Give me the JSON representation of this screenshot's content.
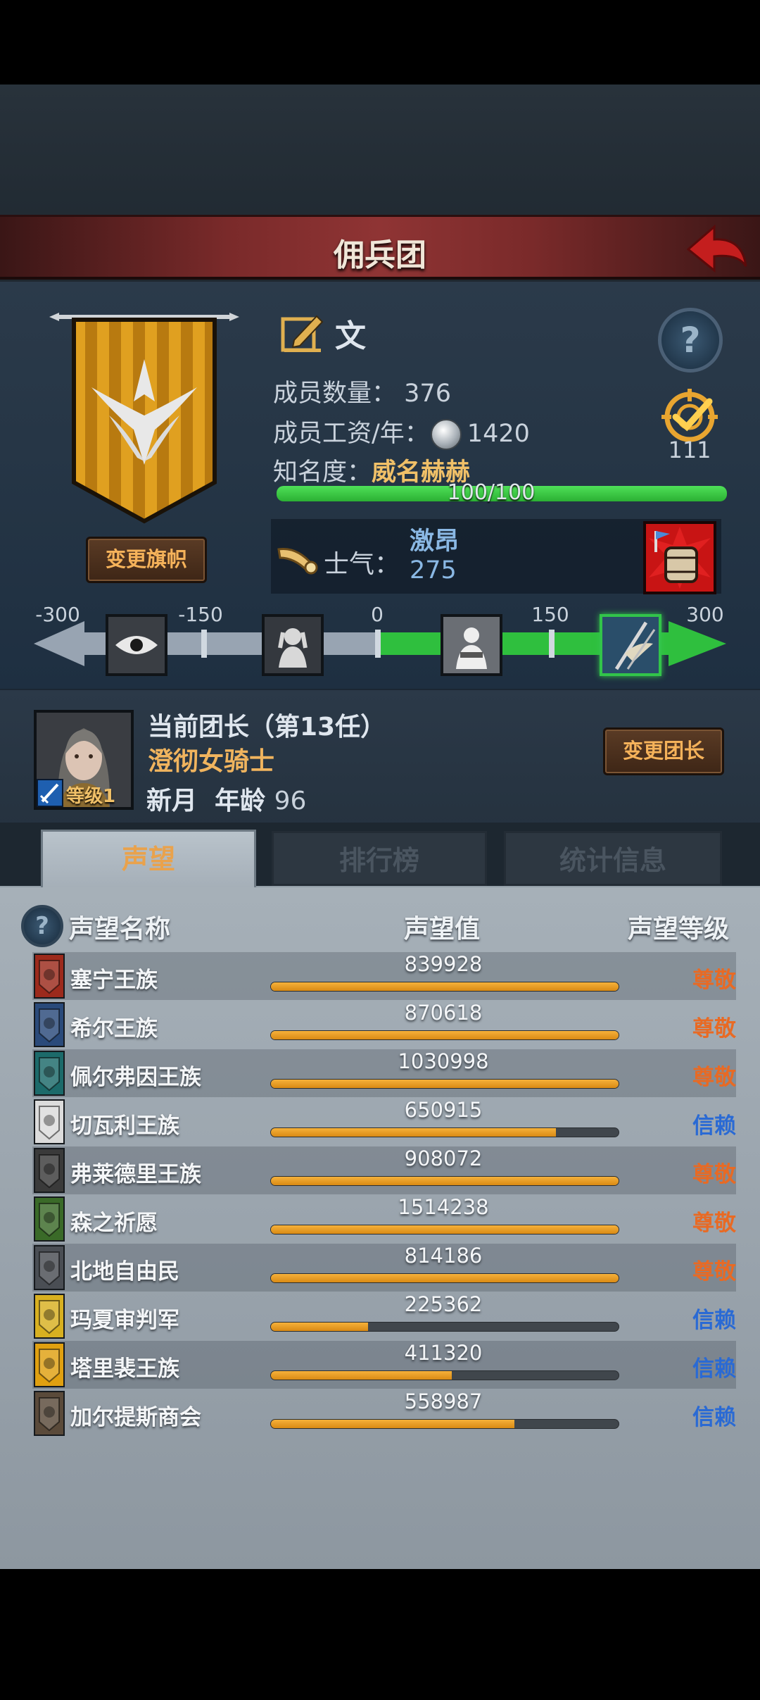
{
  "header": {
    "title": "佣兵团"
  },
  "company": {
    "name": "文",
    "change_flag_label": "变更旗帜",
    "members_label": "成员数量：",
    "members_value": "376",
    "wage_label": "成员工资/年：",
    "wage_value": "1420",
    "fame_label": "知名度：",
    "fame_value": "威名赫赫",
    "fame_progress_text": "100/100",
    "fame_progress": 1.0,
    "task_count": "111"
  },
  "morale": {
    "label": "士气：",
    "state": "激昂",
    "value": "275",
    "scale_ticks": [
      "-300",
      "-150",
      "0",
      "150",
      "300"
    ],
    "scale_states": [
      "eye-icon",
      "weeping-icon",
      "neutral-icon",
      "banner-icon"
    ],
    "active_state_index": 3
  },
  "leader": {
    "title": "当前团长（第13任）",
    "name": "澄彻女骑士",
    "level_label": "等级1",
    "info_name": "新月",
    "age_label": "年龄",
    "age_value": "96",
    "change_label": "变更团长"
  },
  "tabs": [
    {
      "label": "声望",
      "active": true
    },
    {
      "label": "排行榜",
      "active": false
    },
    {
      "label": "统计信息",
      "active": false
    }
  ],
  "reputation": {
    "headers": {
      "name": "声望名称",
      "value": "声望值",
      "level": "声望等级"
    },
    "rows": [
      {
        "name": "塞宁王族",
        "value": "839928",
        "progress": 1.0,
        "level": "尊敬",
        "level_color": "#e86a24",
        "emblem_color": "#9c2a1c"
      },
      {
        "name": "希尔王族",
        "value": "870618",
        "progress": 1.0,
        "level": "尊敬",
        "level_color": "#e86a24",
        "emblem_color": "#2a4a7a"
      },
      {
        "name": "佩尔弗因王族",
        "value": "1030998",
        "progress": 1.0,
        "level": "尊敬",
        "level_color": "#e86a24",
        "emblem_color": "#1c6a6a"
      },
      {
        "name": "切瓦利王族",
        "value": "650915",
        "progress": 0.82,
        "level": "信赖",
        "level_color": "#2a6ad4",
        "emblem_color": "#dcdcdc"
      },
      {
        "name": "弗莱德里王族",
        "value": "908072",
        "progress": 1.0,
        "level": "尊敬",
        "level_color": "#e86a24",
        "emblem_color": "#3a3a3a"
      },
      {
        "name": "森之祈愿",
        "value": "1514238",
        "progress": 1.0,
        "level": "尊敬",
        "level_color": "#e86a24",
        "emblem_color": "#3a6a28"
      },
      {
        "name": "北地自由民",
        "value": "814186",
        "progress": 1.0,
        "level": "尊敬",
        "level_color": "#e86a24",
        "emblem_color": "#4a4e54"
      },
      {
        "name": "玛夏审判军",
        "value": "225362",
        "progress": 0.28,
        "level": "信赖",
        "level_color": "#2a6ad4",
        "emblem_color": "#d8b020"
      },
      {
        "name": "塔里裴王族",
        "value": "411320",
        "progress": 0.52,
        "level": "信赖",
        "level_color": "#2a6ad4",
        "emblem_color": "#e0a010"
      },
      {
        "name": "加尔提斯商会",
        "value": "558987",
        "progress": 0.7,
        "level": "信赖",
        "level_color": "#2a6ad4",
        "emblem_color": "#5a4a3a"
      }
    ]
  }
}
